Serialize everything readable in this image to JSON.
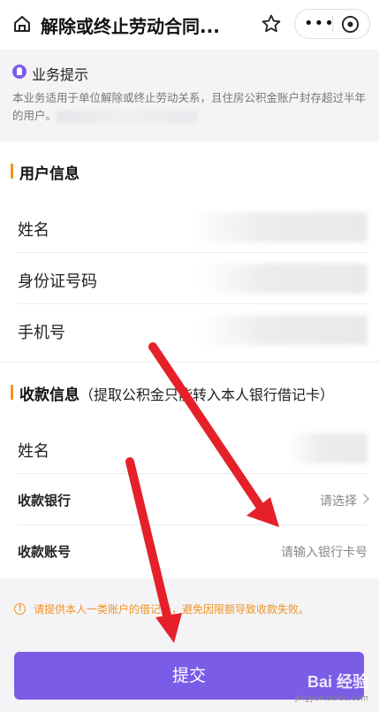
{
  "header": {
    "title": "解除或终止劳动合同...",
    "more_label": "•••"
  },
  "tip": {
    "title": "业务提示",
    "text": "本业务适用于单位解除或终止劳动关系，且住房公积金账户封存超过半年的用户。"
  },
  "user_info": {
    "title": "用户信息",
    "rows": [
      {
        "label": "姓名"
      },
      {
        "label": "身份证号码"
      },
      {
        "label": "手机号"
      }
    ]
  },
  "payment_info": {
    "title": "收款信息",
    "subtitle": "（提取公积金只能转入本人银行借记卡）",
    "rows": [
      {
        "label": "姓名"
      },
      {
        "label": "收款银行",
        "value": "请选择"
      },
      {
        "label": "收款账号",
        "placeholder": "请输入银行卡号"
      }
    ]
  },
  "warning": {
    "text": "请提供本人一类账户的借记卡，避免因限额导致收款失败。"
  },
  "submit": {
    "label": "提交"
  },
  "watermark": {
    "main": "Bai 经验",
    "sub": "jingyan.baidu.com"
  },
  "colors": {
    "accent": "#7b5ce6",
    "section_bar": "#f09324",
    "warning": "#f09324",
    "arrow": "#e5202a"
  }
}
